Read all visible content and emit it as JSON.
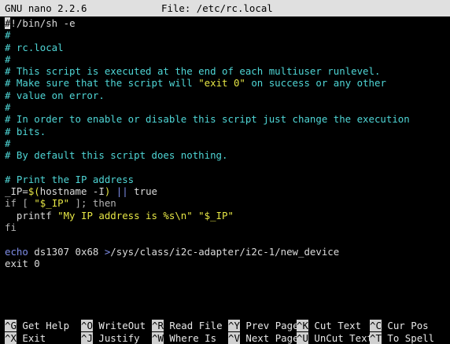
{
  "titlebar": {
    "app": "GNU nano 2.2.6",
    "file": "File: /etc/rc.local"
  },
  "editor_lines": [
    {
      "text": "#!/bin/sh -e"
    },
    {
      "text": "#"
    },
    {
      "text": "# rc.local"
    },
    {
      "text": "#"
    },
    {
      "text": "# This script is executed at the end of each multiuser runlevel."
    },
    {
      "text": "# Make sure that the script will \"exit 0\" on success or any other"
    },
    {
      "text": "# value on error."
    },
    {
      "text": "#"
    },
    {
      "text": "# In order to enable or disable this script just change the execution"
    },
    {
      "text": "# bits."
    },
    {
      "text": "#"
    },
    {
      "text": "# By default this script does nothing."
    },
    {
      "text": ""
    },
    {
      "text": "# Print the IP address"
    },
    {
      "text": "_IP=$(hostname -I) || true"
    },
    {
      "text": "if [ \"$_IP\" ]; then"
    },
    {
      "text": "  printf \"My IP address is %s\\n\" \"$_IP\""
    },
    {
      "text": "fi"
    },
    {
      "text": ""
    },
    {
      "text": "echo ds1307 0x68 >/sys/class/i2c-adapter/i2c-1/new_device"
    },
    {
      "text": "exit 0"
    }
  ],
  "shortcuts_row1": [
    {
      "key": "^G",
      "label": "Get Help"
    },
    {
      "key": "^O",
      "label": "WriteOut"
    },
    {
      "key": "^R",
      "label": "Read File"
    },
    {
      "key": "^Y",
      "label": "Prev Page"
    },
    {
      "key": "^K",
      "label": "Cut Text"
    },
    {
      "key": "^C",
      "label": "Cur Pos"
    }
  ],
  "shortcuts_row2": [
    {
      "key": "^X",
      "label": "Exit"
    },
    {
      "key": "^J",
      "label": "Justify"
    },
    {
      "key": "^W",
      "label": "Where Is"
    },
    {
      "key": "^V",
      "label": "Next Page"
    },
    {
      "key": "^U",
      "label": "UnCut Text"
    },
    {
      "key": "^T",
      "label": "To Spell"
    }
  ],
  "colors": {
    "comment": "#4fd6d6",
    "string": "#e6e645",
    "command": "#7f8ee8",
    "titlebar_bg": "#e0e0e0"
  }
}
